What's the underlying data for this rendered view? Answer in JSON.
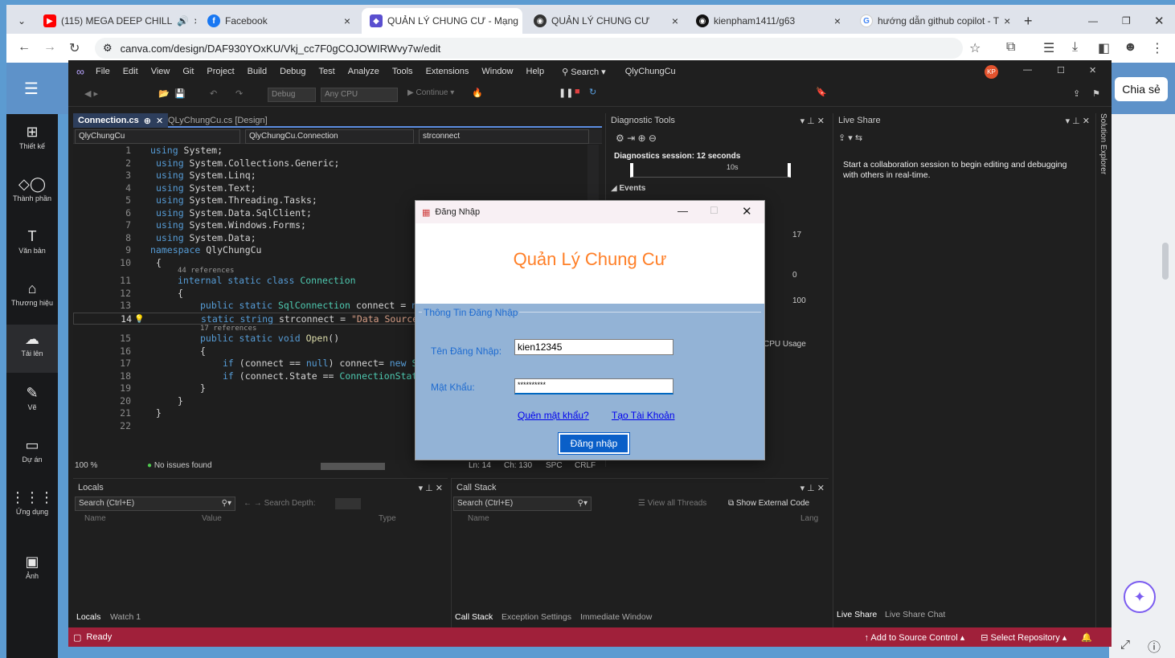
{
  "browser": {
    "tabs": [
      {
        "title": "(115) MEGA DEEP CHILL",
        "icon": "youtube-icon"
      },
      {
        "title": "Facebook",
        "icon": "facebook-icon"
      },
      {
        "title": "QUẢN LÝ CHUNG CƯ - Mạng",
        "icon": "canva-icon"
      },
      {
        "title": "QUẢN LÝ CHUNG CƯ",
        "icon": "github-icon"
      },
      {
        "title": "kienpham1411/g63",
        "icon": "github-icon"
      },
      {
        "title": "hướng dẫn github copilot - T",
        "icon": "google-icon"
      }
    ],
    "url": "canva.com/design/DAF930YOxKU/Vkj_cc7F0gCOJOWIRWvy7w/edit"
  },
  "canva": {
    "share_label": "Chia sẻ",
    "sidebar": [
      {
        "label": "Thiết kế",
        "icon": "layout-icon"
      },
      {
        "label": "Thành phần",
        "icon": "elements-icon"
      },
      {
        "label": "Văn bản",
        "icon": "text-icon"
      },
      {
        "label": "Thương hiệu",
        "icon": "brand-icon"
      },
      {
        "label": "Tải lên",
        "icon": "upload-icon"
      },
      {
        "label": "Vẽ",
        "icon": "draw-icon"
      },
      {
        "label": "Dự án",
        "icon": "folder-icon"
      },
      {
        "label": "Ứng dụng",
        "icon": "apps-icon"
      },
      {
        "label": "Ảnh",
        "icon": "image-icon"
      }
    ]
  },
  "vs": {
    "menu": [
      "File",
      "Edit",
      "View",
      "Git",
      "Project",
      "Build",
      "Debug",
      "Test",
      "Analyze",
      "Tools",
      "Extensions",
      "Window",
      "Help"
    ],
    "search_label": "Search",
    "solution_name": "QlyChungCu",
    "toolbar": {
      "config": "Debug",
      "platform": "Any CPU",
      "continue": "Continue"
    },
    "editor_tabs": [
      "Connection.cs",
      "QLyChungCu.cs [Design]"
    ],
    "nav": {
      "project": "QlyChungCu",
      "class": "QlyChungCu.Connection",
      "member": "strconnect"
    },
    "zoom": "100 %",
    "issues": "No issues found",
    "pos": {
      "ln": "Ln: 14",
      "ch": "Ch: 130",
      "spc": "SPC",
      "crlf": "CRLF"
    },
    "refs": {
      "r44": "44 references",
      "r17": "17 references"
    },
    "diagnostics": {
      "title": "Diagnostic Tools",
      "session": "Diagnostics session: 12 seconds",
      "tick": "10s",
      "events": "Events",
      "v17": "17",
      "v0": "0",
      "v100": "100",
      "cpu": "CPU Usage"
    },
    "liveshare": {
      "title": "Live Share",
      "message": "Start a collaboration session to begin editing and debugging with others in real-time.",
      "tab1": "Live Share",
      "tab2": "Live Share Chat"
    },
    "solution_explorer": "Solution Explorer",
    "locals": {
      "title": "Locals",
      "search": "Search (Ctrl+E)",
      "depth": "Search Depth:",
      "cols": [
        "Name",
        "Value",
        "Type"
      ],
      "tab1": "Locals",
      "tab2": "Watch 1"
    },
    "callstack": {
      "title": "Call Stack",
      "search": "Search (Ctrl+E)",
      "threads": "View all Threads",
      "external": "Show External Code",
      "cols": [
        "Name",
        "Lang"
      ],
      "tab1": "Call Stack",
      "tab2": "Exception Settings",
      "tab3": "Immediate Window"
    },
    "status": {
      "ready": "Ready",
      "source": "Add to Source Control",
      "repo": "Select Repository"
    }
  },
  "dialog": {
    "title": "Đăng Nhập",
    "heading": "Quản Lý Chung Cư",
    "group": "Thông Tin Đăng Nhập",
    "user_label": "Tên Đăng Nhập:",
    "user_value": "kien12345",
    "pass_label": "Mật Khẩu:",
    "pass_value": "**********",
    "forgot": "Quên mật khẩu?",
    "create": "Tạo Tài Khoản",
    "login": "Đăng nhập",
    "accent": "#ff7f27"
  }
}
